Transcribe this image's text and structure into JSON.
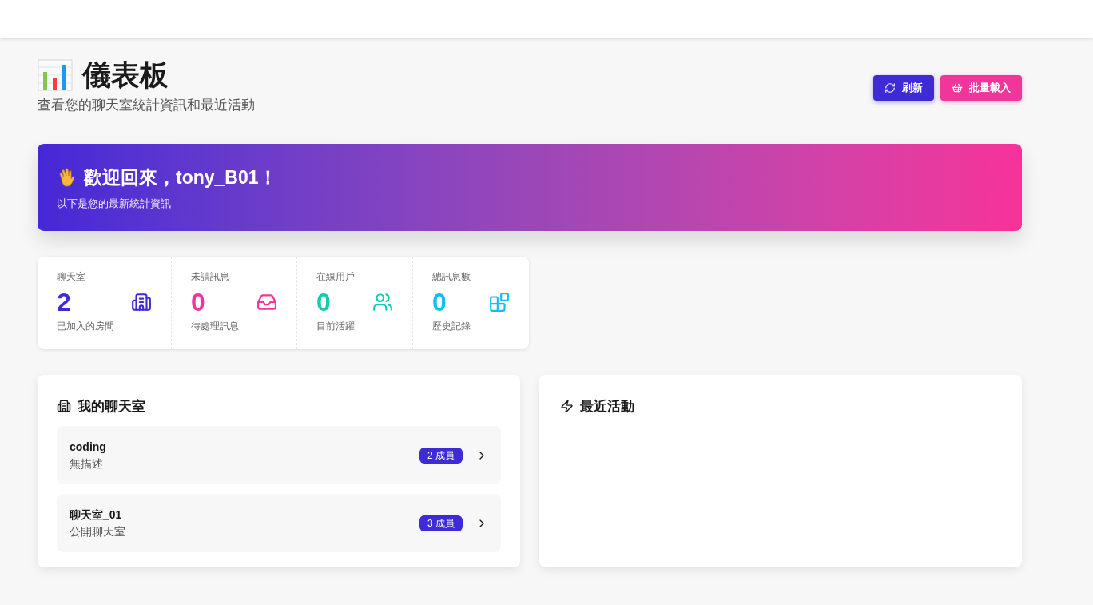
{
  "header": {
    "title": "儀表板",
    "subtitle": "查看您的聊天室統計資訊和最近活動"
  },
  "actions": [
    {
      "label": "刷新",
      "kind": "refresh"
    },
    {
      "label": "批量載入",
      "kind": "load"
    }
  ],
  "welcome": {
    "title": "歡迎回來，tony_B01！",
    "subtitle": "以下是您的最新統計資訊"
  },
  "stats": [
    {
      "label": "聊天室",
      "value": "2",
      "caption": "已加入的房間",
      "color": "#3f2bd6",
      "kind": "rooms"
    },
    {
      "label": "未讀訊息",
      "value": "0",
      "caption": "待處理訊息",
      "color": "#f0369a",
      "kind": "inbox"
    },
    {
      "label": "在線用戶",
      "value": "0",
      "caption": "目前活躍",
      "color": "#12ccb0",
      "kind": "users"
    },
    {
      "label": "總訊息數",
      "value": "0",
      "caption": "歷史記錄",
      "color": "#12bff5",
      "kind": "blocks"
    }
  ],
  "my_rooms": {
    "title": "我的聊天室",
    "rooms": [
      {
        "name": "coding",
        "description": "無描述",
        "members": "2 成員"
      },
      {
        "name": "聊天室_01",
        "description": "公開聊天室",
        "members": "3 成員"
      }
    ]
  },
  "recent_activity": {
    "title": "最近活動"
  }
}
